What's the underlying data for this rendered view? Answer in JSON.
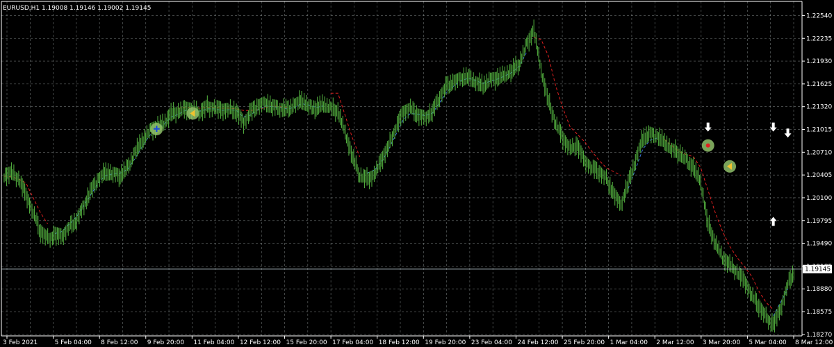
{
  "window": {
    "symbol_line": "EURUSD,H1  1.19008 1.19146 1.19002 1.19145"
  },
  "colors": {
    "background": "#000000",
    "grid": "#9aa3a3",
    "candles": "#4fa83c",
    "fast_line": "#3d7be0",
    "slow_line": "#e02020",
    "price_line": "#b8c8cf",
    "axis": "#ffffff"
  },
  "chart_data": {
    "type": "line",
    "title": "EURUSD,H1  1.19008 1.19146 1.19002 1.19145",
    "ylim": [
      1.1825,
      1.2273
    ],
    "y_ticks": [
      "1.22540",
      "1.22235",
      "1.21930",
      "1.21625",
      "1.21320",
      "1.21015",
      "1.20710",
      "1.20405",
      "1.20100",
      "1.19795",
      "1.19490",
      "1.19185",
      "1.18880",
      "1.18575",
      "1.18270"
    ],
    "current_price_label": "1.19145",
    "current_price": 1.19145,
    "x_ticks": [
      "3 Feb 2021",
      "5 Feb 04:00",
      "8 Feb 12:00",
      "9 Feb 20:00",
      "11 Feb 04:00",
      "12 Feb 12:00",
      "15 Feb 20:00",
      "17 Feb 04:00",
      "18 Feb 12:00",
      "19 Feb 20:00",
      "23 Feb 04:00",
      "24 Feb 12:00",
      "25 Feb 20:00",
      "1 Mar 04:00",
      "2 Mar 12:00",
      "3 Mar 20:00",
      "5 Mar 04:00",
      "8 Mar 12:00"
    ],
    "series": [
      {
        "kind": "price",
        "values": [
          1.204,
          1.2043,
          1.2035,
          1.2015,
          1.199,
          1.1965,
          1.1955,
          1.196,
          1.1958,
          1.1972,
          1.198,
          1.2,
          1.202,
          1.2035,
          1.2045,
          1.2042,
          1.204,
          1.205,
          1.207,
          1.2085,
          1.21,
          1.2105,
          1.211,
          1.2122,
          1.2125,
          1.213,
          1.2128,
          1.2125,
          1.2132,
          1.213,
          1.2127,
          1.2129,
          1.2126,
          1.211,
          1.2125,
          1.2133,
          1.2138,
          1.2132,
          1.213,
          1.2128,
          1.2134,
          1.214,
          1.2132,
          1.213,
          1.2135,
          1.213,
          1.2125,
          1.2098,
          1.2065,
          1.204,
          1.2035,
          1.204,
          1.206,
          1.208,
          1.2105,
          1.2125,
          1.213,
          1.212,
          1.2118,
          1.2125,
          1.2145,
          1.216,
          1.2165,
          1.217,
          1.2172,
          1.2165,
          1.216,
          1.2168,
          1.217,
          1.2175,
          1.218,
          1.219,
          1.2215,
          1.2235,
          1.218,
          1.214,
          1.211,
          1.209,
          1.2075,
          1.208,
          1.206,
          1.205,
          1.2045,
          1.2035,
          1.2015,
          1.2,
          1.203,
          1.206,
          1.209,
          1.2095,
          1.2092,
          1.2085,
          1.2075,
          1.207,
          1.206,
          1.205,
          1.203,
          1.1975,
          1.195,
          1.193,
          1.192,
          1.191,
          1.19,
          1.188,
          1.1865,
          1.185,
          1.184,
          1.186,
          1.1895,
          1.1913
        ]
      },
      {
        "kind": "fast_ma",
        "values": [
          null,
          null,
          null,
          null,
          null,
          null,
          null,
          1.1962,
          1.1965,
          1.1975,
          1.1985,
          1.2,
          1.2015,
          1.203,
          1.204,
          1.2042,
          1.2043,
          1.2048,
          1.2062,
          1.2078,
          1.2093,
          1.2102,
          1.2108,
          1.2118,
          1.2122,
          1.2127,
          1.2127,
          1.2126,
          1.2129,
          1.2129,
          1.2127,
          1.2128,
          1.2127,
          1.2118,
          1.2121,
          1.2128,
          1.2133,
          1.2132,
          1.2131,
          1.2129,
          1.2131,
          1.2136,
          1.2134,
          1.2131,
          1.2133,
          null,
          null,
          null,
          null,
          null,
          1.2043,
          1.2047,
          1.2058,
          1.2075,
          1.2095,
          1.2115,
          1.2123,
          1.2122,
          1.212,
          1.2123,
          1.2137,
          1.2152,
          1.216,
          1.2167,
          1.217,
          1.2167,
          1.2163,
          1.2166,
          1.2169,
          1.2173,
          1.2178,
          1.2186,
          1.2205,
          null,
          null,
          null,
          null,
          null,
          null,
          null,
          null,
          null,
          null,
          null,
          null,
          null,
          1.2022,
          1.2048,
          1.2075,
          1.2087,
          1.209,
          null,
          null,
          null,
          null,
          null,
          null,
          null,
          null,
          null,
          null,
          null,
          null,
          null,
          null,
          null,
          1.1852,
          1.187,
          1.1888
        ]
      },
      {
        "kind": "slow_ma",
        "values": [
          1.2039,
          1.2038,
          1.2035,
          1.203,
          1.201,
          1.199,
          1.1975,
          null,
          null,
          null,
          null,
          null,
          null,
          null,
          null,
          null,
          null,
          null,
          null,
          null,
          null,
          null,
          null,
          null,
          1.213,
          1.2131,
          1.2131,
          1.213,
          1.2131,
          1.2131,
          1.213,
          1.213,
          1.2129,
          1.2127,
          1.2127,
          1.2128,
          1.2131,
          1.2133,
          1.2132,
          1.2131,
          null,
          null,
          null,
          null,
          null,
          1.215,
          1.215,
          1.212,
          1.209,
          1.2065,
          null,
          null,
          null,
          null,
          null,
          null,
          null,
          null,
          null,
          null,
          null,
          null,
          null,
          null,
          null,
          null,
          null,
          null,
          null,
          null,
          null,
          null,
          null,
          1.2225,
          1.2222,
          1.22,
          1.216,
          1.213,
          1.2105,
          1.2095,
          1.2085,
          1.2072,
          1.206,
          1.205,
          1.2045,
          1.204,
          null,
          null,
          null,
          null,
          null,
          1.2088,
          1.208,
          1.2072,
          1.2068,
          1.2065,
          1.205,
          1.202,
          1.199,
          1.1965,
          1.1945,
          1.193,
          1.1918,
          1.1905,
          1.1885,
          1.187,
          1.186,
          null,
          null,
          null
        ]
      }
    ],
    "signals": [
      {
        "type": "buy-arrow",
        "index": 106,
        "price": 1.1977
      },
      {
        "type": "sell-arrow",
        "index": 97,
        "price": 1.2106
      },
      {
        "type": "sell-arrow",
        "index": 106,
        "price": 1.2106
      },
      {
        "type": "sell-arrow",
        "index": 108,
        "price": 1.2098
      }
    ],
    "markers": [
      {
        "type": "blue-cross",
        "index": 21,
        "price": 1.2102
      },
      {
        "type": "yellow-triangle",
        "index": 26,
        "price": 1.2123
      },
      {
        "type": "red-dot",
        "index": 97,
        "price": 1.208
      },
      {
        "type": "yellow-triangle",
        "index": 100,
        "price": 1.2052
      }
    ]
  }
}
